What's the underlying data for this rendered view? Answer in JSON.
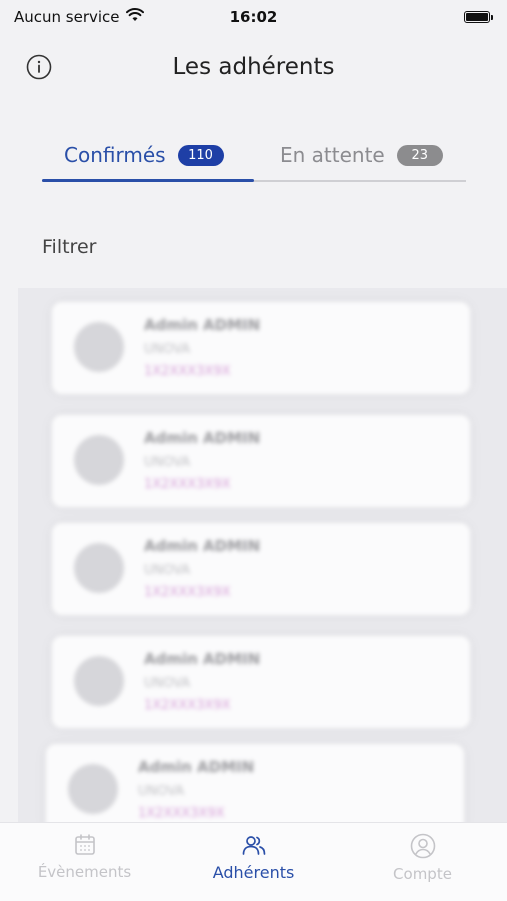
{
  "status_bar": {
    "carrier": "Aucun service",
    "time": "16:02"
  },
  "header": {
    "title": "Les adhérents",
    "info_icon": "info-circle-icon"
  },
  "tabs": [
    {
      "label": "Confirmés",
      "count": "110",
      "active": true
    },
    {
      "label": "En attente",
      "count": "23",
      "active": false
    }
  ],
  "filter": {
    "label": "Filtrer"
  },
  "members": [
    {
      "name": "Admin ADMIN",
      "org": "UNOVA",
      "number": "1X2XXX3X9X"
    },
    {
      "name": "Admin ADMIN",
      "org": "UNOVA",
      "number": "1X2XXX3X9X"
    },
    {
      "name": "Admin ADMIN",
      "org": "UNOVA",
      "number": "1X2XXX3X9X"
    },
    {
      "name": "Admin ADMIN",
      "org": "UNOVA",
      "number": "1X2XXX3X9X"
    },
    {
      "name": "Admin ADMIN",
      "org": "UNOVA",
      "number": "1X2XXX3X9X"
    }
  ],
  "bottom_nav": [
    {
      "label": "Évènements",
      "icon": "calendar-icon",
      "active": false
    },
    {
      "label": "Adhérents",
      "icon": "users-icon",
      "active": true
    },
    {
      "label": "Compte",
      "icon": "user-circle-icon",
      "active": false
    }
  ],
  "colors": {
    "accent": "#2a4fa8",
    "badge_active": "#1e3fa6",
    "badge_inactive": "#8c8c8e",
    "background": "#f2f2f4"
  }
}
